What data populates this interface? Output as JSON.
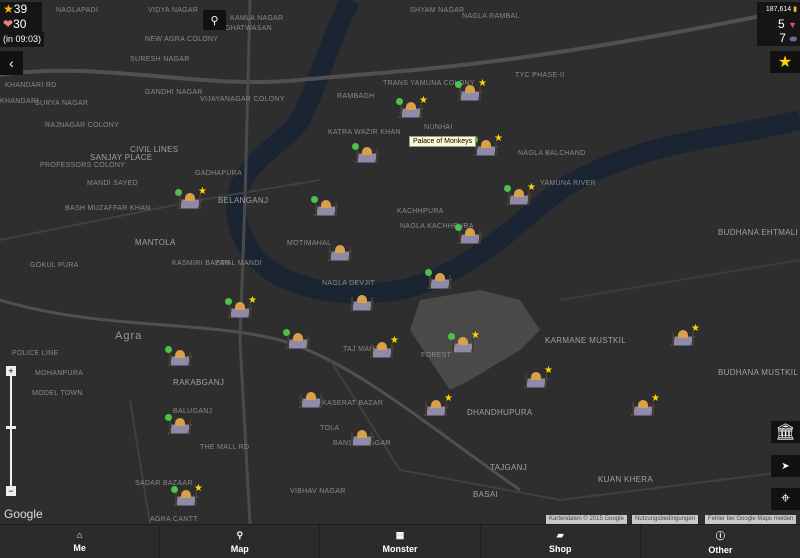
{
  "stats": {
    "stars": "39",
    "hearts": "30",
    "timer": "(in 09:03)",
    "gold": "187,614",
    "gems": "5",
    "items": "7"
  },
  "map": {
    "labels": [
      "Naglapadi",
      "Vidya Nagar",
      "Kamla Nagar",
      "Shyam Nagar",
      "Nagla Rambal",
      "New Agra Colony",
      "Ghatwasan",
      "Suresh Nagar",
      "Khandari",
      "Surya Nagar",
      "Gandhi Nagar",
      "Vijayanagar Colony",
      "Trans Yamuna Colony",
      "Rambagh",
      "TYC Phase-II",
      "Rajnagar Colony",
      "Civil Lines",
      "Sanjay Place",
      "Katra Wazir Khan",
      "Nunhai",
      "Nagla Balchand",
      "Professors Colony",
      "Gadhapura",
      "Belanganj",
      "Mandi Sayed",
      "Bash Muzaffar Khan",
      "Mantola",
      "Kachhpura",
      "Nagla Kachhpura",
      "Motimahal",
      "Gokul Pura",
      "Kasmiri Bazar",
      "Pipal Mandi",
      "Nagla Devjit",
      "Budhana Ehtmali",
      "Agra",
      "Police Line",
      "Rakabganj",
      "Mohanpura",
      "Model Town",
      "Taj Mahal",
      "Forest",
      "Karmane Mustkil",
      "Budhana Mustkil",
      "Kaserat Bazar",
      "Dhandhupura",
      "Baluganj",
      "Tola",
      "Bansal Nagar",
      "Tajganj",
      "Kuan Khera",
      "Sadar Bazaar",
      "Vibhav Nagar",
      "Basai",
      "Agra Cantt",
      "Yamuna River",
      "The Mall Rd",
      "Khandari Rd"
    ],
    "tooltip": "Palace of Monkeys",
    "attribution": [
      "Kartendaten © 2015 Google",
      "Nutzungsbedingungen",
      "Fehler bei Google Maps melden"
    ],
    "google_logo": "Google",
    "zoom_level": 0.45,
    "colors": {
      "river": "#1a2433",
      "forest": "#4a4a4a",
      "road": "#4f4f4f"
    }
  },
  "nav": [
    {
      "label": "Me",
      "icon": "home-icon"
    },
    {
      "label": "Map",
      "icon": "map-pin-icon"
    },
    {
      "label": "Monster",
      "icon": "grid-icon"
    },
    {
      "label": "Shop",
      "icon": "shopping-bag-icon"
    },
    {
      "label": "Other",
      "icon": "info-icon"
    }
  ]
}
